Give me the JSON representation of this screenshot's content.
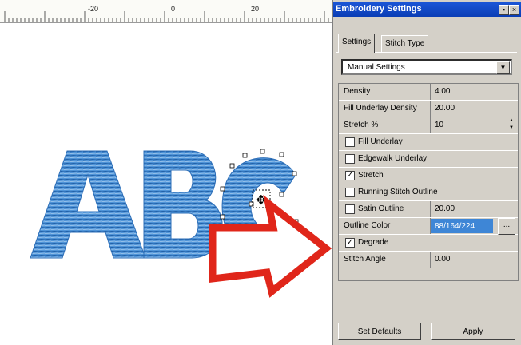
{
  "ruler": {
    "labels": [
      "-20",
      "0",
      "20"
    ]
  },
  "canvas": {
    "letters": "ABC"
  },
  "panel": {
    "title": "Embroidery Settings",
    "pin_glyph": "▪",
    "close_glyph": "×",
    "tabs": [
      {
        "label": "Settings",
        "active": true
      },
      {
        "label": "Stitch Type",
        "active": false
      }
    ],
    "dropdown": {
      "value": "Manual Settings"
    },
    "properties": [
      {
        "label": "Density",
        "value": "4.00",
        "kind": "value"
      },
      {
        "label": "Fill Underlay Density",
        "value": "20.00",
        "kind": "value"
      },
      {
        "label": "Stretch %",
        "value": "10",
        "kind": "spin"
      },
      {
        "label": "Fill Underlay",
        "checked": false,
        "kind": "check"
      },
      {
        "label": "Edgewalk Underlay",
        "checked": false,
        "kind": "check"
      },
      {
        "label": "Stretch",
        "checked": true,
        "kind": "check"
      },
      {
        "label": "Running Stitch Outline",
        "checked": false,
        "kind": "check"
      },
      {
        "label": "Satin Outline",
        "checked": false,
        "kind": "check",
        "value": "20.00"
      },
      {
        "label": "Outline Color",
        "value": "88/164/224",
        "kind": "color",
        "color": "#58A4E0"
      },
      {
        "label": "Degrade",
        "checked": true,
        "kind": "check"
      },
      {
        "label": "Stitch Angle",
        "value": "0.00",
        "kind": "value"
      }
    ],
    "buttons": {
      "set_defaults": "Set Defaults",
      "apply": "Apply"
    }
  },
  "colors": {
    "accent": "#1b55d6",
    "stitch_blue": "#3e86d6",
    "arrow_red": "#e0261a"
  }
}
